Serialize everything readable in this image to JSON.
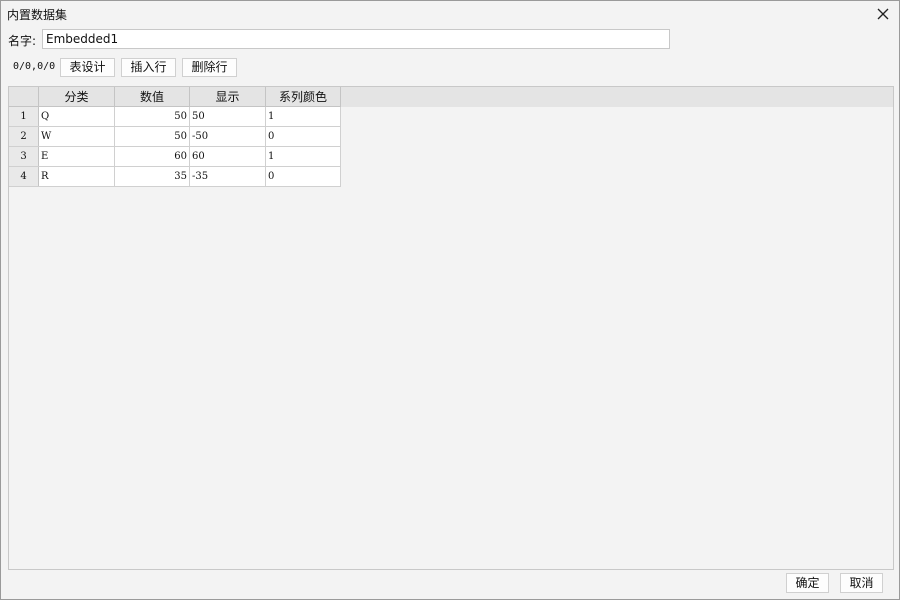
{
  "window": {
    "title": "内置数据集",
    "close_icon": "close-icon"
  },
  "name_field": {
    "label": "名字:",
    "value": "Embedded1"
  },
  "toolbar": {
    "position": "0/0,0/0",
    "table_design_label": "表设计",
    "insert_row_label": "插入行",
    "delete_row_label": "删除行"
  },
  "table": {
    "columns": [
      "",
      "分类",
      "数值",
      "显示",
      "系列颜色"
    ],
    "rows": [
      {
        "num": "1",
        "category": "Q",
        "value": "50",
        "display": "50",
        "color": "1"
      },
      {
        "num": "2",
        "category": "W",
        "value": "50",
        "display": "-50",
        "color": "0"
      },
      {
        "num": "3",
        "category": "E",
        "value": "60",
        "display": "60",
        "color": "1"
      },
      {
        "num": "4",
        "category": "R",
        "value": "35",
        "display": "-35",
        "color": "0"
      }
    ]
  },
  "footer": {
    "ok_label": "确定",
    "cancel_label": "取消"
  },
  "colors": {
    "window_bg": "#f3f3f3",
    "grid_header_bg": "#e4e4e4",
    "cell_bg": "#ffffff"
  }
}
